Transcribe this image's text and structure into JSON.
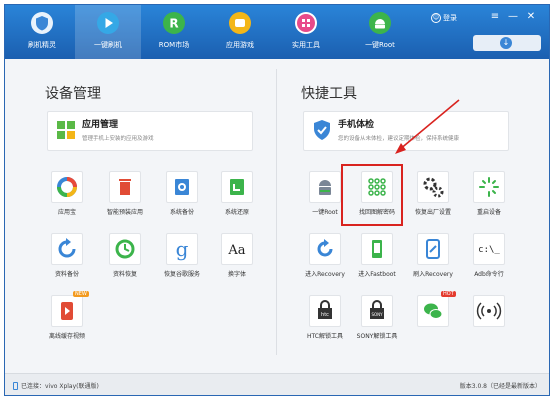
{
  "nav": [
    {
      "label": "刷机精灵",
      "icon": "shield-logo-icon",
      "color": "#3a86d6"
    },
    {
      "label": "一键刷机",
      "icon": "play-icon",
      "color": "#35a8e6"
    },
    {
      "label": "ROM市场",
      "icon": "rom-r-icon",
      "color": "#3cb44b"
    },
    {
      "label": "应用游戏",
      "icon": "apps-icon",
      "color": "#f3b617"
    },
    {
      "label": "实用工具",
      "icon": "toolbox-icon",
      "color": "#e84a8a"
    },
    {
      "label": "一键Root",
      "icon": "android-icon",
      "color": "#3cb44b"
    }
  ],
  "topright": {
    "login": "登录",
    "minimize": "—",
    "menu": "≡",
    "close": "✕",
    "download": "↓"
  },
  "device_section": {
    "title": "设备管理",
    "card": {
      "title": "应用管理",
      "desc": "管理手机上安装的应用及游戏"
    },
    "tiles": [
      {
        "label": "应用宝",
        "icon": "app-store-icon"
      },
      {
        "label": "智能预装应用",
        "icon": "trash-icon"
      },
      {
        "label": "系统备份",
        "icon": "system-backup-icon"
      },
      {
        "label": "系统还原",
        "icon": "system-restore-icon"
      },
      {
        "label": "资料备份",
        "icon": "data-backup-icon"
      },
      {
        "label": "资料恢复",
        "icon": "data-restore-icon"
      },
      {
        "label": "恢复谷歌服务",
        "icon": "google-icon"
      },
      {
        "label": "换字体",
        "icon": "font-icon",
        "glyph": "Aa"
      },
      {
        "label": "离线缓存视频",
        "icon": "video-cache-icon",
        "badge": "NEW"
      }
    ]
  },
  "tools_section": {
    "title": "快捷工具",
    "card": {
      "title": "手机体检",
      "desc": "您的设备从未体检，建议定期体检，保持系统健康"
    },
    "tiles": [
      {
        "label": "一键Root",
        "icon": "android-root-icon"
      },
      {
        "label": "找回图解密码",
        "icon": "pattern-unlock-icon"
      },
      {
        "label": "恢复出厂设置",
        "icon": "factory-reset-icon"
      },
      {
        "label": "重启设备",
        "icon": "reboot-icon"
      },
      {
        "label": "进入Recovery",
        "icon": "recovery-icon"
      },
      {
        "label": "进入Fastboot",
        "icon": "fastboot-icon"
      },
      {
        "label": "刷入Recovery",
        "icon": "flash-recovery-icon"
      },
      {
        "label": "Adb命令行",
        "icon": "terminal-icon",
        "glyph": "c:\\_"
      },
      {
        "label": "HTC解锁工具",
        "icon": "htc-unlock-icon",
        "glyph": "htc"
      },
      {
        "label": "SONY解锁工具",
        "icon": "sony-unlock-icon",
        "glyph": "SONY"
      },
      {
        "label": "",
        "icon": "wechat-icon",
        "badge": "HOT"
      },
      {
        "label": "",
        "icon": "wireless-icon"
      }
    ]
  },
  "status": {
    "left": "已连接：vivo Xplay(联通版)",
    "right": "版本3.0.8（已经是最新版本）"
  }
}
